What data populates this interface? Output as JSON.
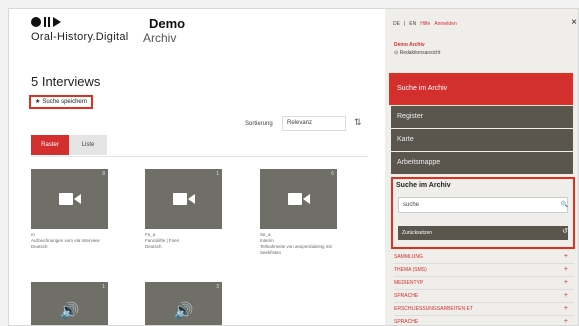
{
  "header": {
    "logo_text": "Oral-History.Digital",
    "project_title": "Demo",
    "project_subtitle": "Archiv"
  },
  "results": {
    "title": "5 Interviews",
    "save_search": "Suche speichern",
    "sort_label": "Sortierung",
    "sort_value": "Relevanz",
    "sort_dir_icon": "sort-direction-icon"
  },
  "view_tabs": [
    {
      "label": "Raster",
      "active": true
    },
    {
      "label": "Liste",
      "active": false
    }
  ],
  "cards": [
    {
      "count": "8",
      "media": "video",
      "meta1": "m",
      "meta2": "Aufzeichnungen vom ela Interview",
      "meta3": "Deutsch"
    },
    {
      "count": "1",
      "media": "video",
      "meta1": "Fe_a",
      "meta2": "Fancsilifte | Foen",
      "meta3": "Deutsch"
    },
    {
      "count": "6",
      "media": "video",
      "meta1": "Se_a",
      "meta2": "Interim",
      "meta3": "Tellnahmeite von anspreizabreig mit Seekfisten"
    },
    {
      "count": "1",
      "media": "audio",
      "meta1": "",
      "meta2": "",
      "meta3": ""
    },
    {
      "count": "3",
      "media": "audio",
      "meta1": "",
      "meta2": "",
      "meta3": ""
    }
  ],
  "sidebar": {
    "lang_current": "DE",
    "lang_other": "EN",
    "link_help": "Hilfe",
    "link_account": "Anmelden",
    "close_icon": "close-icon",
    "archive_title": "Demo Archiv",
    "archive_link": "Redaktionsansicht",
    "nav": [
      "Suche im Archiv",
      "Register",
      "Karte",
      "Arbeitsmappe"
    ],
    "search": {
      "label": "Suche im Archiv",
      "value": "suche",
      "reset": "Zurücksetzen"
    },
    "facets": [
      "SAMMLUNG",
      "THEMA (SMS)",
      "MEDIENTYP",
      "SPRACHE",
      "ERSCHLIESSUNGSARBEITEN ET",
      "SPRACHE"
    ]
  },
  "colors": {
    "accent": "#d32f2f",
    "nav_dark": "#5a564e",
    "thumb": "#6f6e67"
  }
}
